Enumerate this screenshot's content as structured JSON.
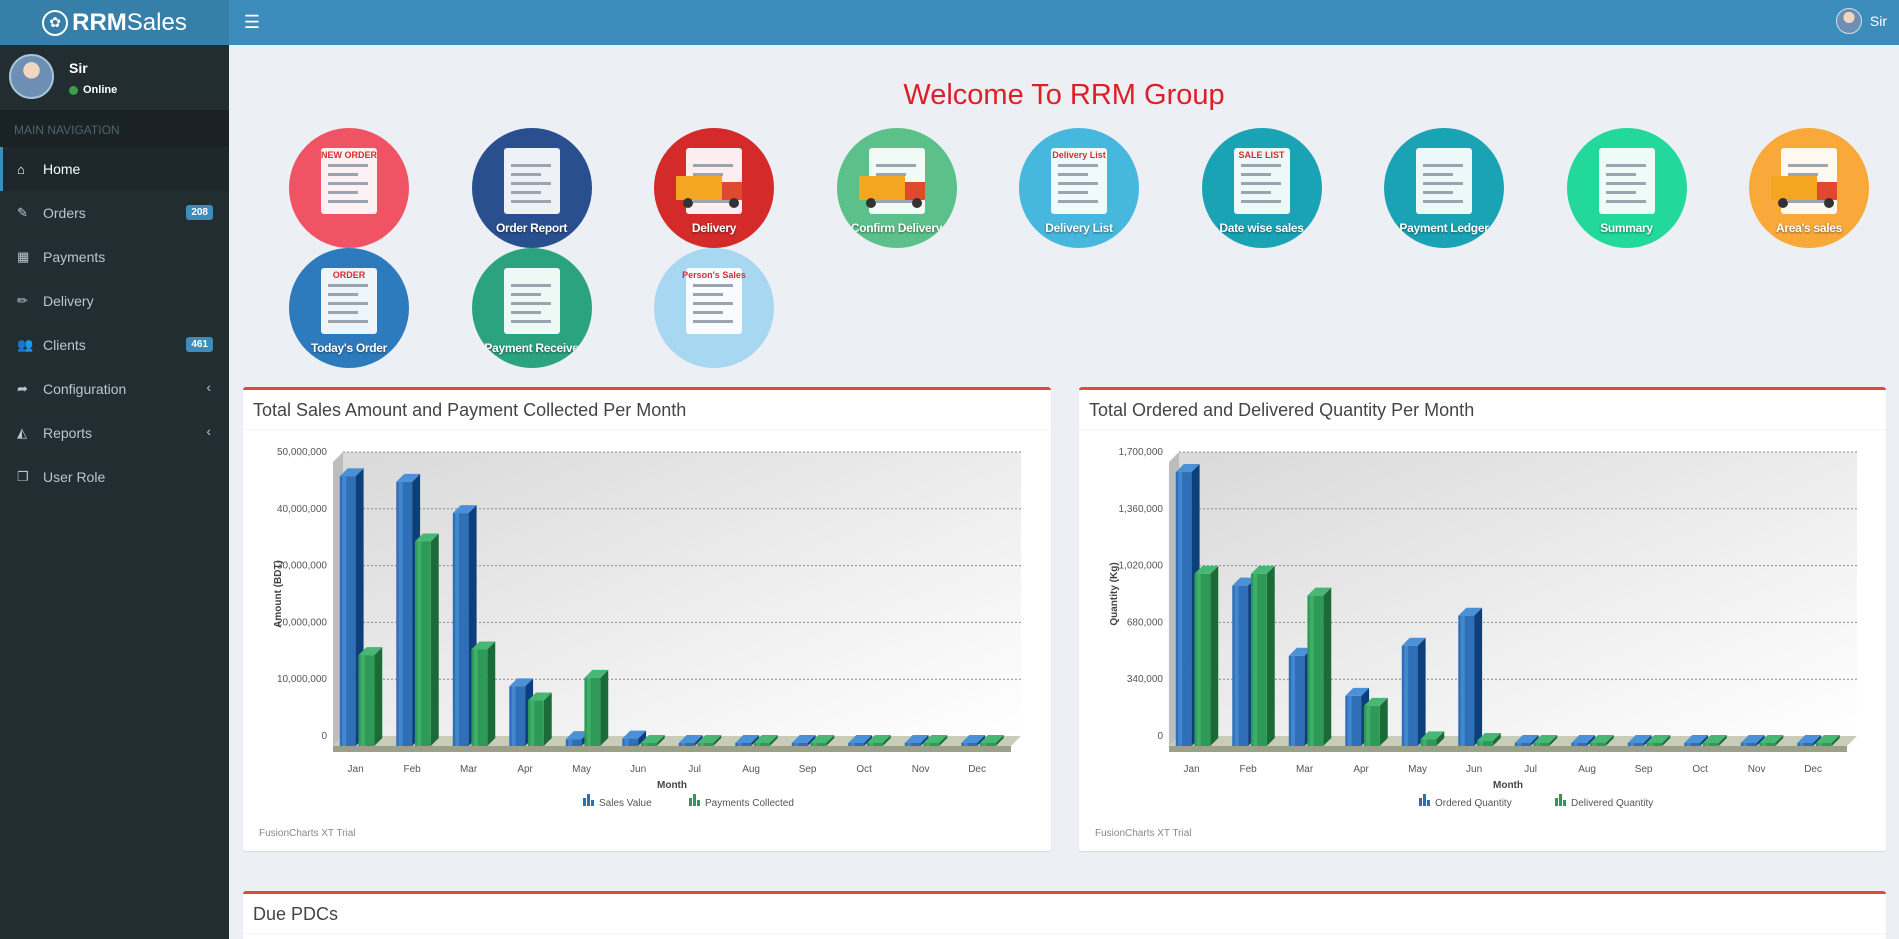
{
  "app": {
    "logo_bold": "RRM",
    "logo_rest": "Sales"
  },
  "header": {
    "user_name": "Sir"
  },
  "sidebar": {
    "user_name": "Sir",
    "status": "Online",
    "nav_header": "MAIN NAVIGATION",
    "items": [
      {
        "label": "Home",
        "icon": "home-icon"
      },
      {
        "label": "Orders",
        "icon": "edit-icon",
        "badge": "208"
      },
      {
        "label": "Payments",
        "icon": "grid-icon"
      },
      {
        "label": "Delivery",
        "icon": "pencil-icon"
      },
      {
        "label": "Clients",
        "icon": "users-icon",
        "badge": "461"
      },
      {
        "label": "Configuration",
        "icon": "share-icon"
      },
      {
        "label": "Reports",
        "icon": "area-chart-icon"
      },
      {
        "label": "User Role",
        "icon": "copy-icon"
      }
    ]
  },
  "main": {
    "welcome": "Welcome To RRM Group",
    "tiles": [
      {
        "label": "",
        "top_text": "NEW ORDER",
        "color": "#f05464"
      },
      {
        "label": "Order Report",
        "color": "#2a4f8f"
      },
      {
        "label": "Delivery",
        "color": "#d42a2a"
      },
      {
        "label": "Confirm Delivery",
        "color": "#5cc08a"
      },
      {
        "label": "Delivery List",
        "top_text": "Delivery List",
        "color": "#47b8dd"
      },
      {
        "label": "Date wise sales",
        "top_text": "SALE LIST",
        "color": "#1aa3b5"
      },
      {
        "label": "Payment Ledger",
        "color": "#1aa3b5"
      },
      {
        "label": "Summary",
        "color": "#22d89a"
      },
      {
        "label": "Area's sales",
        "color": "#f8a93a"
      },
      {
        "label": "Today's Order",
        "top_text": "ORDER",
        "color": "#2d7bbd"
      },
      {
        "label": "Payment Receive",
        "color": "#2ba37e"
      },
      {
        "label": "",
        "top_text": "Person's Sales",
        "color": "#a8d7f2"
      }
    ],
    "due_title": "Due PDCs",
    "fc_note": "FusionCharts XT Trial"
  },
  "chart_data": [
    {
      "type": "bar",
      "title": "Total Sales Amount and Payment Collected Per Month",
      "xlabel": "Month",
      "ylabel": "Amount (BDT)",
      "ylim": [
        0,
        50000000
      ],
      "yticks": [
        "0",
        "10,000,000",
        "20,000,000",
        "30,000,000",
        "40,000,000",
        "50,000,000"
      ],
      "categories": [
        "Jan",
        "Feb",
        "Mar",
        "Apr",
        "May",
        "Jun",
        "Jul",
        "Aug",
        "Sep",
        "Oct",
        "Nov",
        "Dec"
      ],
      "series": [
        {
          "name": "Sales Value",
          "color": "#2e6fb8",
          "values": [
            47500000,
            46500000,
            41000000,
            10500000,
            1200000,
            1300000,
            0,
            0,
            0,
            0,
            0,
            0
          ]
        },
        {
          "name": "Payments Collected",
          "color": "#2e9a57",
          "values": [
            16000000,
            36000000,
            17000000,
            8000000,
            12000000,
            0,
            0,
            0,
            0,
            0,
            0,
            0
          ]
        }
      ],
      "legend": "bottom",
      "grid": true
    },
    {
      "type": "bar",
      "title": "Total Ordered and Delivered Quantity Per Month",
      "xlabel": "Month",
      "ylabel": "Quantity (Kg)",
      "ylim": [
        0,
        1700000
      ],
      "yticks": [
        "0",
        "340,000",
        "680,000",
        "1,020,000",
        "1,360,000",
        "1,700,000"
      ],
      "categories": [
        "Jan",
        "Feb",
        "Mar",
        "Apr",
        "May",
        "Jun",
        "Jul",
        "Aug",
        "Sep",
        "Oct",
        "Nov",
        "Dec"
      ],
      "series": [
        {
          "name": "Ordered Quantity",
          "color": "#2e6fb8",
          "values": [
            1640000,
            960000,
            540000,
            300000,
            600000,
            780000,
            0,
            0,
            0,
            0,
            0,
            0
          ]
        },
        {
          "name": "Delivered Quantity",
          "color": "#2e9a57",
          "values": [
            1030000,
            1030000,
            900000,
            240000,
            40000,
            30000,
            0,
            0,
            0,
            0,
            0,
            0
          ]
        }
      ],
      "legend": "bottom",
      "grid": true
    }
  ]
}
